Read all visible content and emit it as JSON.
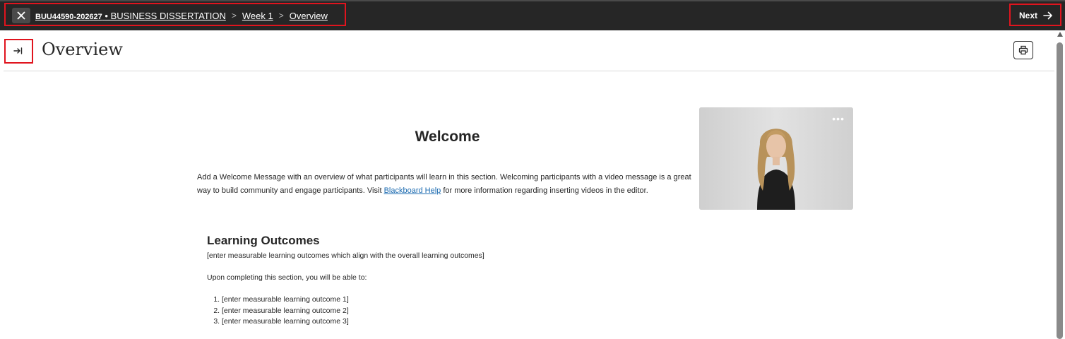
{
  "header": {
    "breadcrumb": {
      "course_code": "BUU44590-202627",
      "course_name": "• BUSINESS DISSERTATION",
      "week": "Week 1",
      "current": "Overview",
      "separator": ">"
    },
    "next_label": "Next"
  },
  "page": {
    "title": "Overview"
  },
  "content": {
    "welcome_heading": "Welcome",
    "welcome_message_pre": "Add a Welcome Message with an overview of what participants will learn in this section. Welcoming participants with a video message is a great way to build community and engage participants. Visit ",
    "welcome_link": "Blackboard Help",
    "welcome_message_post": " for more information regarding inserting videos in the editor.",
    "video_more": "•••",
    "learning_outcomes_heading": "Learning Outcomes",
    "learning_outcomes_note": "[enter measurable learning outcomes which align with the overall learning outcomes]",
    "learning_outcomes_intro": "Upon completing this section, you will be able to:",
    "outcomes": [
      "[enter measurable learning outcome 1]",
      "[enter measurable learning outcome 2]",
      "[enter measurable learning outcome 3]"
    ]
  },
  "colors": {
    "topbar": "#262626",
    "highlight": "#e0141e",
    "link": "#1a6ab0"
  },
  "icons": [
    "close-icon",
    "arrow-right-icon",
    "expand-panel-icon",
    "print-icon",
    "more-icon"
  ]
}
